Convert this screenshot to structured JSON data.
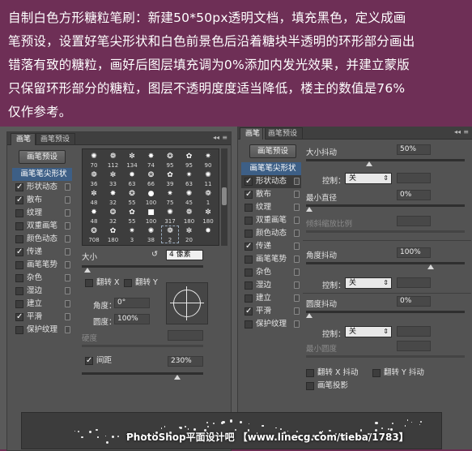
{
  "banner": {
    "lines": [
      "自制白色方形糖粒笔刷：新建50*50px透明文档，填充黑色，定义成画",
      "笔预设，设置好笔尖形状和白色前景色后沿着糖块半透明的环形部分画出",
      "错落有致的糖粒，画好后图层填充调为0%添加内发光效果，并建立蒙版",
      "只保留环形部分的糖粒，图层不透明度度适当降低，楼主的数值是76%",
      "仅作参考。"
    ]
  },
  "left": {
    "tabs": [
      "画笔",
      "画笔预设"
    ],
    "preset_button": "画笔预设",
    "list": [
      {
        "label": "画笔笔尖形状",
        "highlight": true
      },
      {
        "label": "形状动态",
        "checked": true
      },
      {
        "label": "散布",
        "checked": true
      },
      {
        "label": "纹理",
        "checked": false
      },
      {
        "label": "双重画笔",
        "checked": false
      },
      {
        "label": "颜色动态",
        "checked": false
      },
      {
        "label": "传递",
        "checked": true
      },
      {
        "label": "画笔笔势",
        "checked": false
      },
      {
        "label": "杂色",
        "checked": false
      },
      {
        "label": "湿边",
        "checked": false
      },
      {
        "label": "建立",
        "checked": false
      },
      {
        "label": "平滑",
        "checked": true
      },
      {
        "label": "保护纹理",
        "checked": false
      }
    ],
    "brush_sizes": [
      [
        "70",
        "112",
        "134",
        "74",
        "95",
        "95",
        "90"
      ],
      [
        "36",
        "33",
        "63",
        "66",
        "39",
        "63",
        "11"
      ],
      [
        "48",
        "32",
        "55",
        "100",
        "75",
        "45",
        "1"
      ],
      [
        "48",
        "32",
        "55",
        "100",
        "317",
        "180",
        "180"
      ],
      [
        "708",
        "180",
        "3",
        "38",
        "2",
        "20",
        ""
      ]
    ],
    "size_label": "大小",
    "size_value": "4 像素",
    "flip_x": "翻转 X",
    "flip_y": "翻转 Y",
    "angle_label": "角度：",
    "angle_value": "0°",
    "roundness_label": "圆度：",
    "roundness_value": "100%",
    "hardness_label": "硬度",
    "spacing_label": "间距",
    "spacing_value": "230%"
  },
  "right": {
    "tabs": [
      "画笔",
      "画笔预设"
    ],
    "preset_button": "画笔预设",
    "list": [
      {
        "label": "画笔笔尖形状",
        "highlight": true
      },
      {
        "label": "形状动态",
        "checked": true,
        "selected": true
      },
      {
        "label": "散布",
        "checked": true
      },
      {
        "label": "纹理",
        "checked": false
      },
      {
        "label": "双重画笔",
        "checked": false
      },
      {
        "label": "颜色动态",
        "checked": false
      },
      {
        "label": "传递",
        "checked": true
      },
      {
        "label": "画笔笔势",
        "checked": false
      },
      {
        "label": "杂色",
        "checked": false
      },
      {
        "label": "湿边",
        "checked": false
      },
      {
        "label": "建立",
        "checked": false
      },
      {
        "label": "平滑",
        "checked": true
      },
      {
        "label": "保护纹理",
        "checked": false
      }
    ],
    "size_jitter_label": "大小抖动",
    "size_jitter_value": "50%",
    "control_label": "控制：",
    "control_value": "关",
    "min_diameter_label": "最小直径",
    "min_diameter_value": "0%",
    "tilt_scale_label": "倾斜缩放比例",
    "angle_jitter_label": "角度抖动",
    "angle_jitter_value": "100%",
    "roundness_jitter_label": "圆度抖动",
    "roundness_jitter_value": "0%",
    "min_roundness_label": "最小圆度",
    "flip_x_jitter": "翻转 X 抖动",
    "flip_y_jitter": "翻转 Y 抖动",
    "brush_projection": "画笔投影"
  },
  "watermark": "PhotoShop平面设计吧 【www.linecg.com/tieba/1783】"
}
